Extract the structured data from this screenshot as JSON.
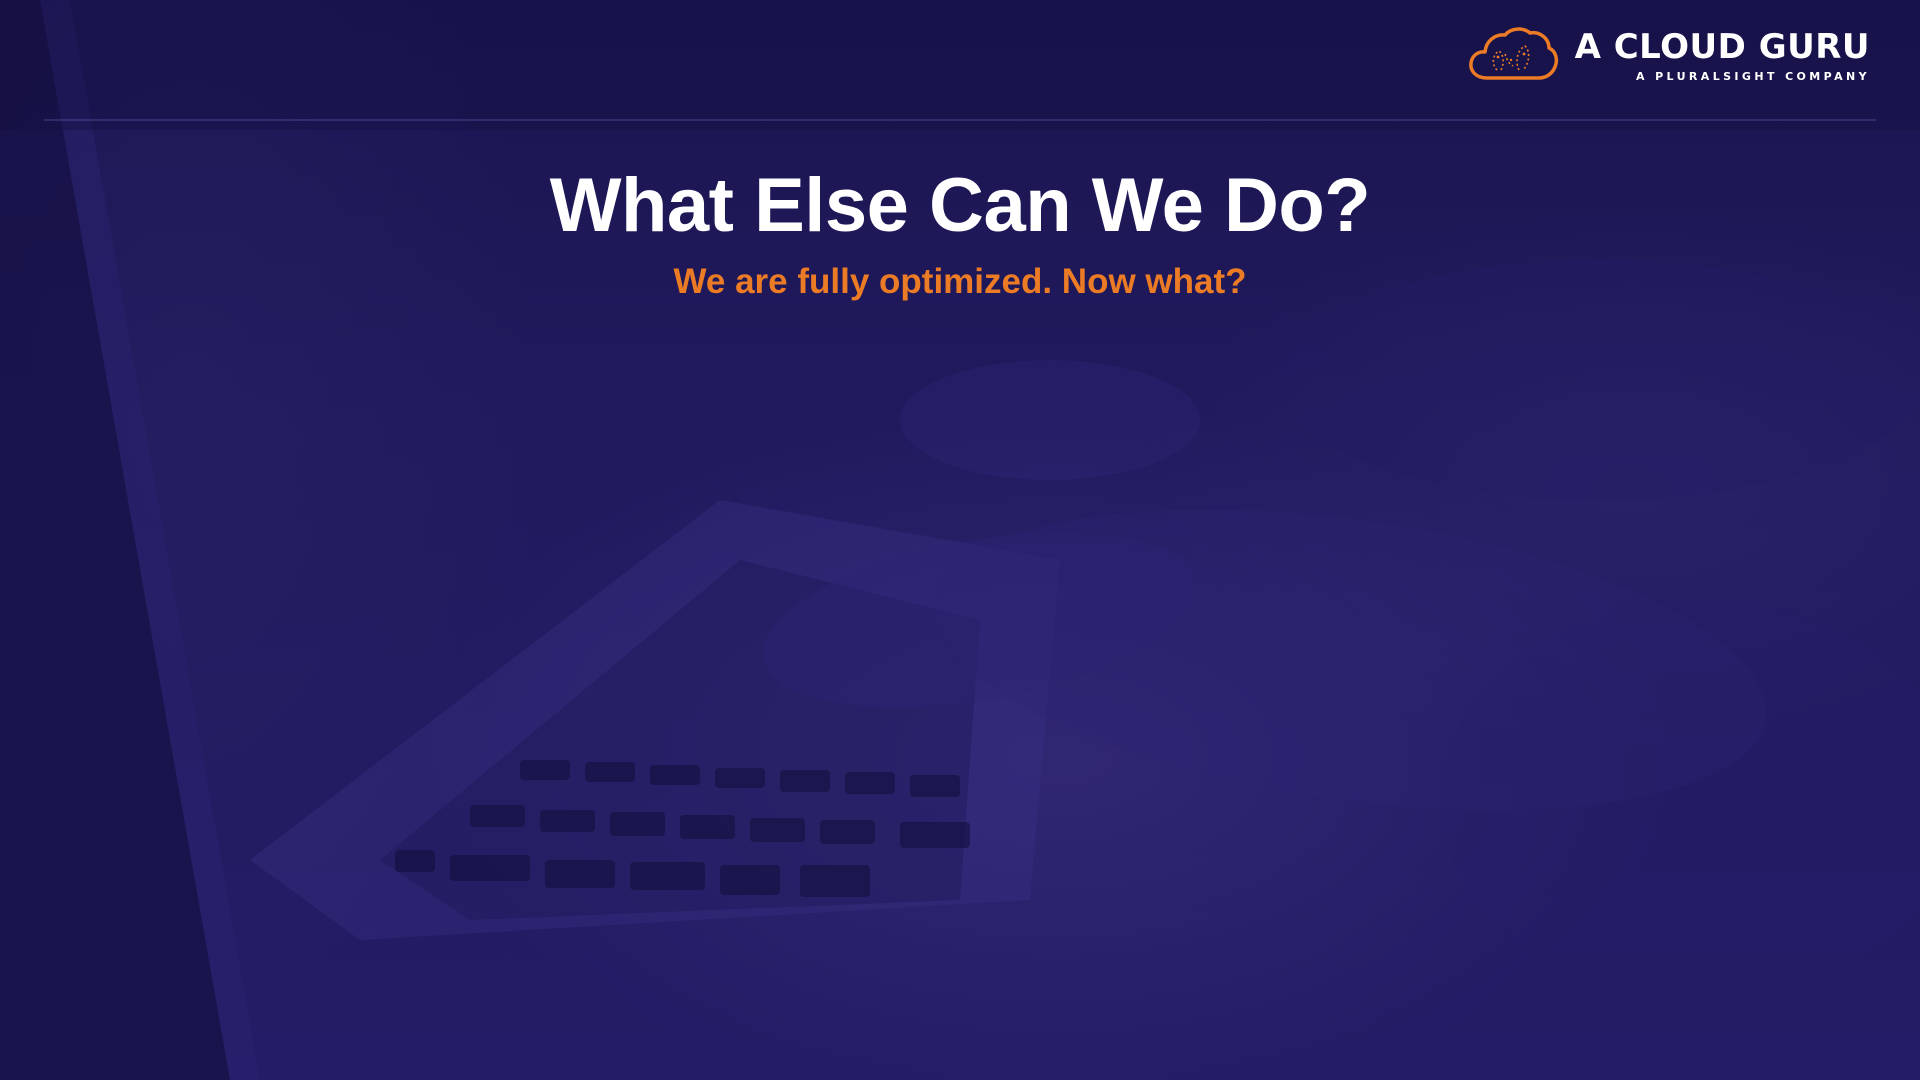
{
  "brand": {
    "name": "A CLOUD GURU",
    "tagline": "A PLURALSIGHT COMPANY",
    "accent_color": "#ec7b25",
    "logo_icon": "cloud-logo-icon"
  },
  "slide": {
    "title": "What Else Can We Do?",
    "subtitle": "We are fully optimized. Now what?",
    "background_color": "#1c1650",
    "background_image": "laptop-typing-photo"
  }
}
